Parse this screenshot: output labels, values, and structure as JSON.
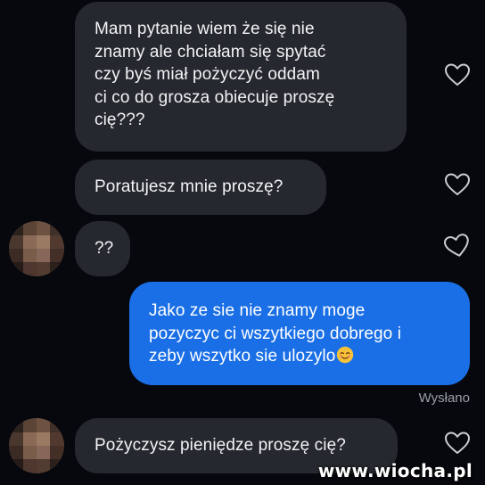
{
  "messages": [
    {
      "direction": "incoming",
      "lines": [
        "Mam pytanie wiem że się nie",
        "znamy ale chciałam się spytać",
        "czy byś miał pożyczyć oddam",
        "ci co do grosza obiecuje proszę",
        "cię???"
      ]
    },
    {
      "direction": "incoming",
      "lines": [
        "Poratujesz mnie proszę?"
      ]
    },
    {
      "direction": "incoming",
      "lines": [
        "??"
      ]
    },
    {
      "direction": "outgoing",
      "lines": [
        "Jako ze sie nie znamy moge",
        "pozyczyc ci wszytkiego dobrego i",
        "zeby wszytko sie ulozylo"
      ],
      "emoji": "smiling-face-emoji"
    },
    {
      "direction": "incoming",
      "lines": [
        "Pożyczysz pieniędze proszę cię?"
      ]
    }
  ],
  "status": "Wysłano",
  "watermark": "www.wiocha.pl",
  "icons": {
    "like": "heart-outline-icon",
    "avatar": "blurred-avatar",
    "emoji": "smiling-face-emoji"
  },
  "colors": {
    "background": "#06080d",
    "incoming_bubble": "#25282e",
    "outgoing_bubble": "#1a6fe6",
    "text": "#f2f3f5",
    "status_text": "#9aa0a8"
  }
}
